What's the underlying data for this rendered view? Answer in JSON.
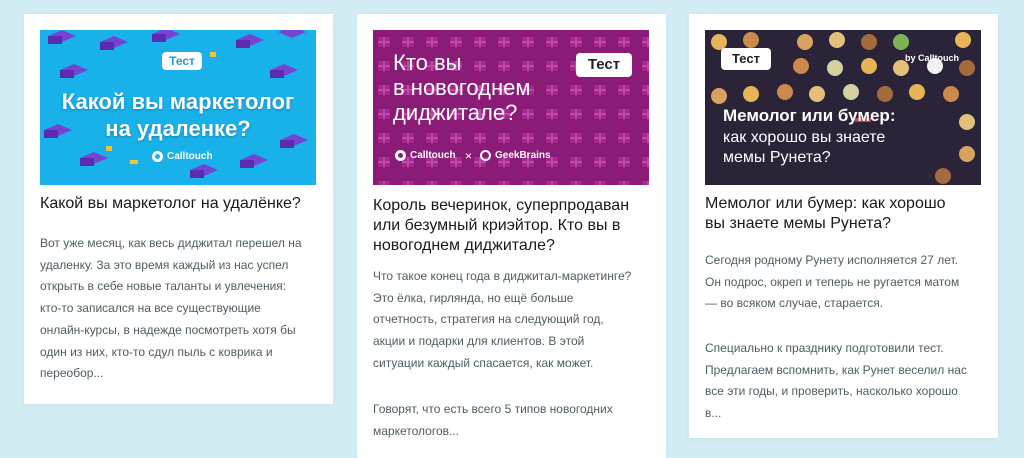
{
  "colors": {
    "page_background": "#d2edf3",
    "card_background": "#ffffff",
    "cover_1": "#19b1e9",
    "cover_2": "#8a1b76",
    "cover_3": "#2b2337",
    "title_text": "#1a1a1a",
    "body_text": "#4d5d63"
  },
  "cards": [
    {
      "cover": {
        "badge": "Тест",
        "title_lines": [
          "Какой вы маркетолог",
          "на удаленке?"
        ],
        "brand": "Calltouch",
        "brand_icon": "calltouch-logo-icon"
      },
      "title": "Какой вы маркетолог на удалёнке?",
      "paragraphs": [
        [
          "Вот уже месяц, как весь диджитал перешел на",
          "удаленку. За это время каждый из нас успел",
          "открыть в себе новые таланты и увлечения:",
          "кто-то записался на все существующие",
          "онлайн-курсы, в надежде посмотреть хотя бы",
          "один из них, кто-то сдул пыль с коврика и",
          "переобор..."
        ]
      ]
    },
    {
      "cover": {
        "badge": "Тест",
        "title_lines": [
          "Кто вы",
          "в новогоднем",
          "диджитале?"
        ],
        "brand_a": "Calltouch",
        "separator": "×",
        "brand_b": "GeekBrains",
        "brand_icon_a": "calltouch-logo-icon",
        "brand_icon_b": "geekbrains-logo-icon"
      },
      "title_lines": [
        "Король вечеринок, суперпродаван",
        "или безумный криэйтор. Кто вы в",
        "новогоднем диджитале?"
      ],
      "paragraphs": [
        [
          "Что такое конец года в диджитал-маркетинге?",
          "Это ёлка, гирлянда, но ещё больше",
          "отчетность, стратегия на следующий год,",
          "акции и подарки для клиентов. В этой",
          "ситуации каждый спасается, как может."
        ],
        [
          "Говорят, что есть всего 5 типов новогодних",
          "маркетологов..."
        ]
      ]
    },
    {
      "cover": {
        "badge": "Тест",
        "title_bold": "Мемолог или бумер:",
        "title_lines": [
          "как хорошо вы знаете",
          "мемы Рунета?"
        ],
        "brand": "by Calltouch"
      },
      "title_lines": [
        "Мемолог или бумер: как хорошо",
        "вы знаете мемы Рунета?"
      ],
      "paragraphs": [
        [
          "Сегодня родному Рунету исполняется 27 лет.",
          "Он подрос, окреп и теперь не ругается матом",
          "— во всяком случае, старается."
        ],
        [
          "Специально к празднику подготовили тест.",
          "Предлагаем вспомнить, как Рунет веселил нас",
          "все эти годы, и проверить, насколько хорошо",
          "в..."
        ]
      ]
    }
  ]
}
